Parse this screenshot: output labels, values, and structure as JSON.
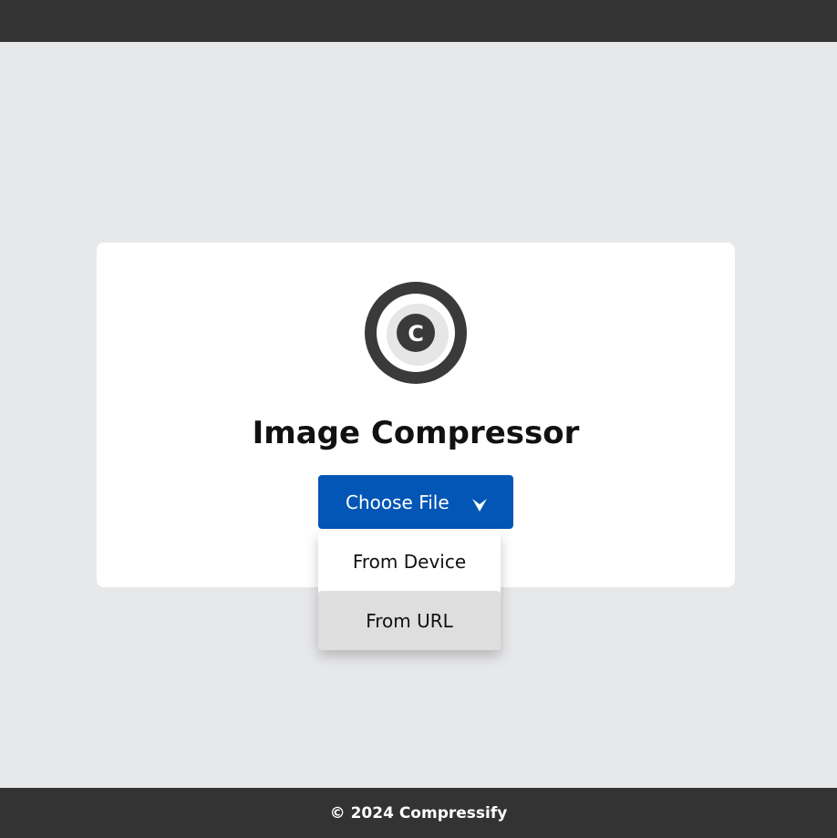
{
  "header": {},
  "card": {
    "logo_icon": "compress-c-icon",
    "title": "Image Compressor"
  },
  "choose_file": {
    "label": "Choose File",
    "icon": "chevron-down-icon",
    "color": "#0356b5"
  },
  "dropdown": {
    "items": [
      {
        "label": "From Device"
      },
      {
        "label": "From URL"
      }
    ]
  },
  "footer": {
    "text": "© 2024 Compressify"
  }
}
